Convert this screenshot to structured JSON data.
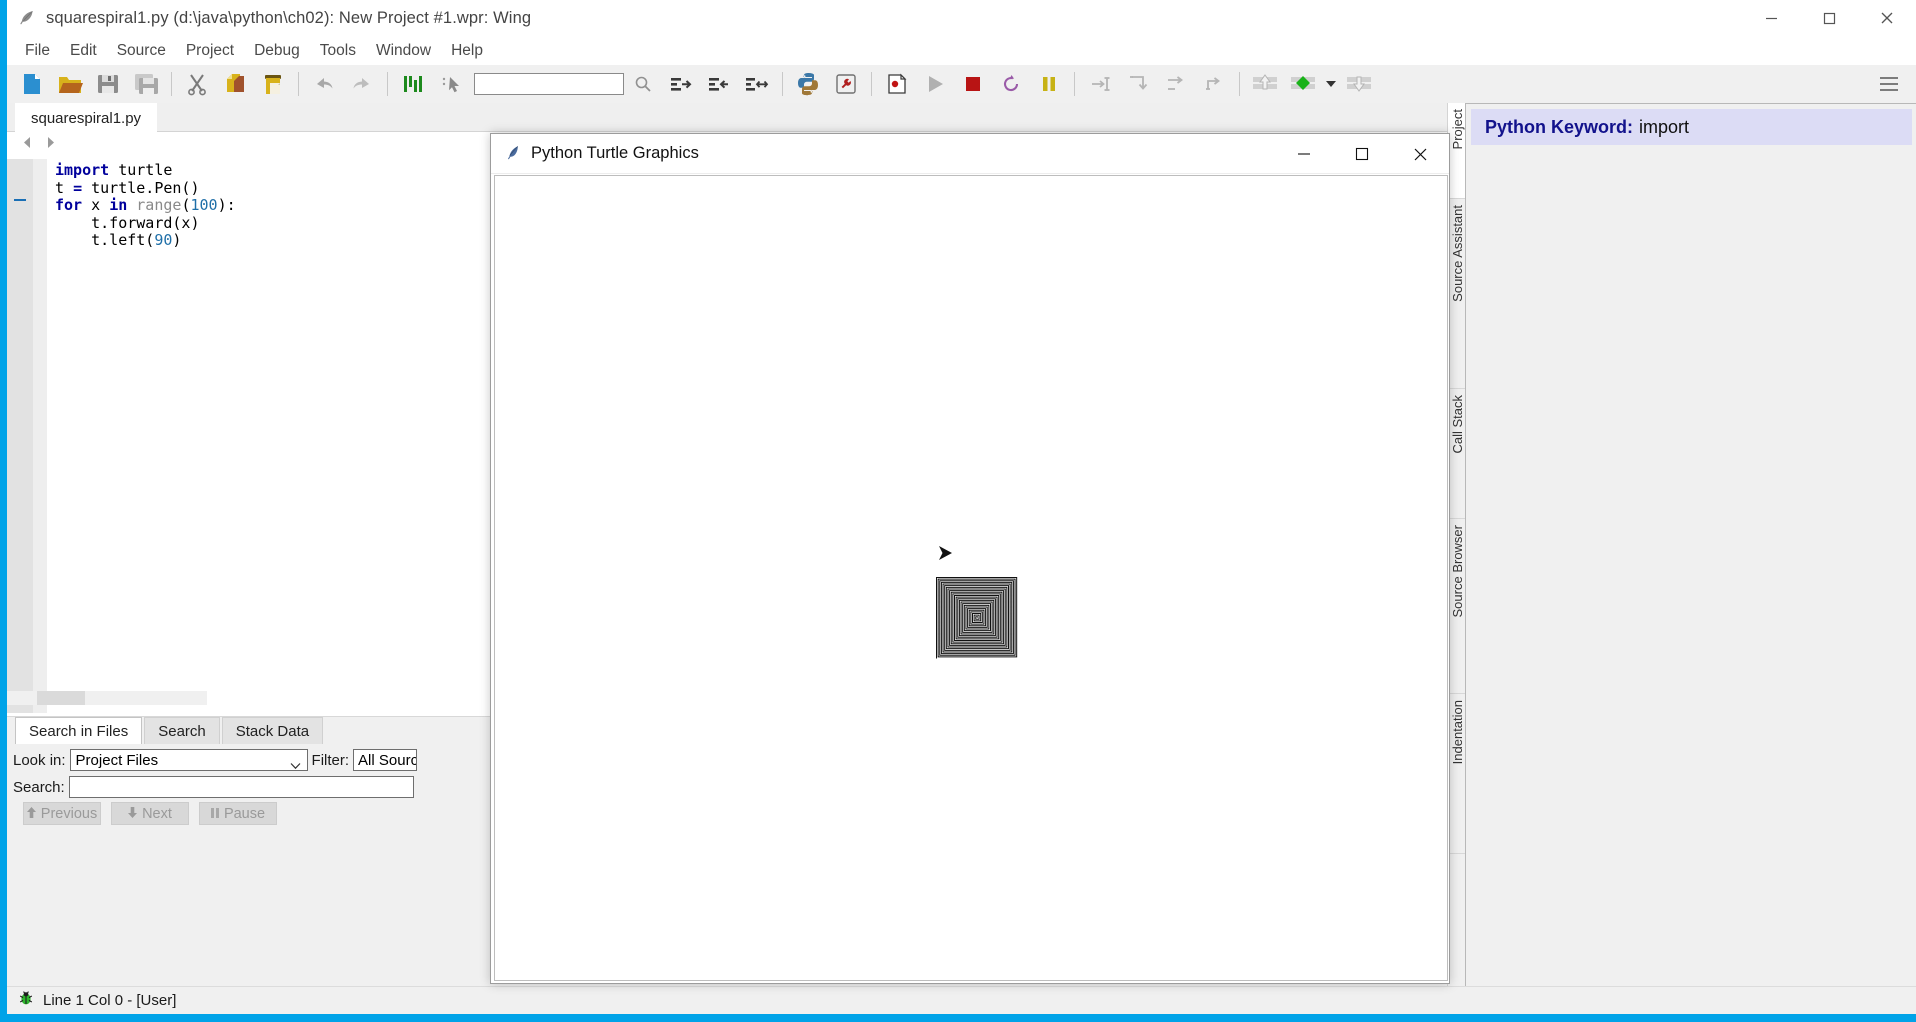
{
  "window": {
    "title": "squarespiral1.py (d:\\java\\python\\ch02): New Project #1.wpr: Wing",
    "icon": "feather-icon",
    "minimize_label": "—",
    "maximize_label": "□",
    "close_label": "✕"
  },
  "menu": {
    "items": [
      {
        "label": "File"
      },
      {
        "label": "Edit"
      },
      {
        "label": "Source"
      },
      {
        "label": "Project"
      },
      {
        "label": "Debug"
      },
      {
        "label": "Tools"
      },
      {
        "label": "Window"
      },
      {
        "label": "Help"
      }
    ]
  },
  "toolbar": {
    "search_value": "",
    "search_placeholder": "",
    "buttons": [
      {
        "name": "new-file-icon",
        "tooltip": "New File"
      },
      {
        "name": "open-folder-icon",
        "tooltip": "Open"
      },
      {
        "name": "save-icon",
        "tooltip": "Save"
      },
      {
        "name": "save-all-icon",
        "tooltip": "Save All"
      },
      {
        "name": "cut-icon",
        "tooltip": "Cut"
      },
      {
        "name": "copy-icon",
        "tooltip": "Copy"
      },
      {
        "name": "paste-icon",
        "tooltip": "Paste"
      },
      {
        "name": "undo-icon",
        "tooltip": "Undo"
      },
      {
        "name": "redo-icon",
        "tooltip": "Redo"
      },
      {
        "name": "indent-guides-icon",
        "tooltip": "Show Indent Guides"
      },
      {
        "name": "select-pointer-icon",
        "tooltip": "Select"
      },
      {
        "name": "search-icon",
        "tooltip": "Search"
      },
      {
        "name": "indent-right-icon",
        "tooltip": "Indent"
      },
      {
        "name": "indent-left-icon",
        "tooltip": "Outdent"
      },
      {
        "name": "indent-match-icon",
        "tooltip": "Match Indent"
      },
      {
        "name": "python-shell-icon",
        "tooltip": "Python Shell"
      },
      {
        "name": "debug-probe-icon",
        "tooltip": "Debug Probe"
      },
      {
        "name": "set-breakpoint-icon",
        "tooltip": "Breakpoint"
      },
      {
        "name": "run-icon",
        "tooltip": "Start / Continue"
      },
      {
        "name": "stop-icon",
        "tooltip": "Stop"
      },
      {
        "name": "restart-icon",
        "tooltip": "Restart"
      },
      {
        "name": "pause-icon",
        "tooltip": "Pause"
      },
      {
        "name": "step-into-icon",
        "tooltip": "Step Into"
      },
      {
        "name": "step-over-icon",
        "tooltip": "Step Over"
      },
      {
        "name": "step-out-icon",
        "tooltip": "Step Out"
      },
      {
        "name": "step-return-icon",
        "tooltip": "Step Out Of"
      },
      {
        "name": "stack-up-icon",
        "tooltip": "Up Stack"
      },
      {
        "name": "stack-frame-icon",
        "tooltip": "Select Frame"
      },
      {
        "name": "stack-dropdown-icon",
        "tooltip": "Frames"
      },
      {
        "name": "stack-down-icon",
        "tooltip": "Down Stack"
      }
    ],
    "menu_icon": "hamburger-icon"
  },
  "editor": {
    "tab_label": "squarespiral1.py",
    "nav_back": "◀",
    "nav_forward": "▶",
    "code_lines": [
      [
        {
          "t": "import",
          "c": "kw"
        },
        {
          "t": " turtle",
          "c": "pl"
        }
      ],
      [
        {
          "t": "t ",
          "c": "pl"
        },
        {
          "t": "=",
          "c": "kw"
        },
        {
          "t": " turtle.Pen()",
          "c": "pl"
        }
      ],
      [
        {
          "t": "for",
          "c": "kw"
        },
        {
          "t": " x ",
          "c": "pl"
        },
        {
          "t": "in",
          "c": "kw"
        },
        {
          "t": " ",
          "c": "pl"
        },
        {
          "t": "range",
          "c": "bi"
        },
        {
          "t": "(",
          "c": "pl"
        },
        {
          "t": "100",
          "c": "num"
        },
        {
          "t": "):",
          "c": "pl"
        }
      ],
      [
        {
          "t": "    t.forward(x)",
          "c": "pl"
        }
      ],
      [
        {
          "t": "    t.left(",
          "c": "pl"
        },
        {
          "t": "90",
          "c": "num"
        },
        {
          "t": ")",
          "c": "pl"
        }
      ]
    ]
  },
  "bottom_panel": {
    "tabs": [
      {
        "label": "Search in Files",
        "active": true
      },
      {
        "label": "Search",
        "active": false
      },
      {
        "label": "Stack Data",
        "active": false
      }
    ],
    "look_in_label": "Look in:",
    "look_in_value": "Project Files",
    "filter_label": "Filter:",
    "filter_value": "All Source",
    "search_label": "Search:",
    "search_value": "",
    "buttons": [
      {
        "label": "Previous",
        "icon": "arrow-up-icon"
      },
      {
        "label": "Next",
        "icon": "arrow-down-icon"
      },
      {
        "label": "Pause",
        "icon": "pause-icon"
      }
    ]
  },
  "vertical_tabs": [
    {
      "label": "Project",
      "active": true
    },
    {
      "label": "Source Assistant",
      "active": false
    },
    {
      "label": "Call Stack",
      "active": false
    },
    {
      "label": "Source Browser",
      "active": false
    },
    {
      "label": "Indentation",
      "active": false
    }
  ],
  "source_assistant": {
    "header_key": "Python Keyword:",
    "header_value": "import"
  },
  "statusbar": {
    "icon": "bug-icon",
    "text": "Line 1 Col 0 - [User]"
  },
  "turtle_window": {
    "icon": "feather-icon",
    "title": "Python Turtle Graphics",
    "minimize_label": "—",
    "maximize_label": "□",
    "close_label": "✕",
    "drawing": "square-spiral",
    "turtle_cursor": "turtle-arrow"
  },
  "colors": {
    "accent_blue": "#00a3e8",
    "keyword": "#00009c",
    "builtin": "#8a8a8a",
    "number": "#1f6fa8",
    "assistant_bg": "#dcdcf5",
    "toolbar_bg": "#f0f0f0"
  }
}
